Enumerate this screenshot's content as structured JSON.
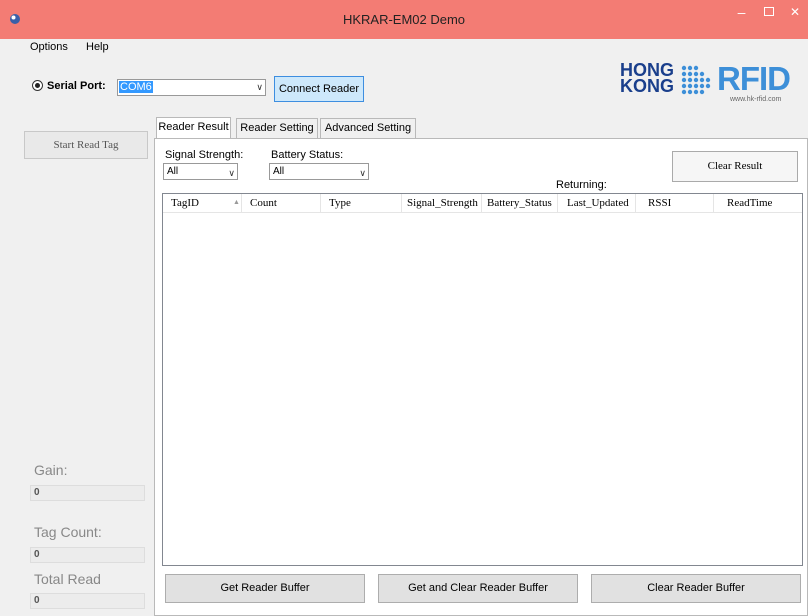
{
  "window": {
    "title": "HKRAR-EM02 Demo",
    "minimize_glyph": "–",
    "close_glyph": "✕",
    "titlebar_color": "#f37c74"
  },
  "menu": {
    "items": [
      "Options",
      "Help"
    ]
  },
  "connection": {
    "serial_port_label": "Serial Port:",
    "port_value": "COM6",
    "connect_label": "Connect Reader"
  },
  "logo": {
    "line1": "HONG",
    "line2": "KONG",
    "brand": "RFID",
    "url": "www.hk-rfid.com"
  },
  "left_panel": {
    "start_read_label": "Start Read Tag",
    "gain_label": "Gain:",
    "gain_value": "0",
    "tag_count_label": "Tag Count:",
    "tag_count_value": "0",
    "total_read_label": "Total  Read",
    "total_read_value": "0"
  },
  "tabs": [
    "Reader Result",
    "Reader Setting",
    "Advanced Setting"
  ],
  "filters": {
    "signal_label": "Signal Strength:",
    "signal_value": "All",
    "battery_label": "Battery Status:",
    "battery_value": "All",
    "clear_result_label": "Clear Result",
    "returning_label": "Returning:"
  },
  "table": {
    "columns": [
      "TagID",
      "Count",
      "Type",
      "Signal_Strength",
      "Battery_Status",
      "Last_Updated",
      "RSSI",
      "ReadTime"
    ],
    "rows": []
  },
  "bottom_buttons": {
    "get_buffer": "Get Reader Buffer",
    "get_and_clear": "Get and Clear Reader Buffer",
    "clear_buffer": "Clear Reader Buffer"
  }
}
